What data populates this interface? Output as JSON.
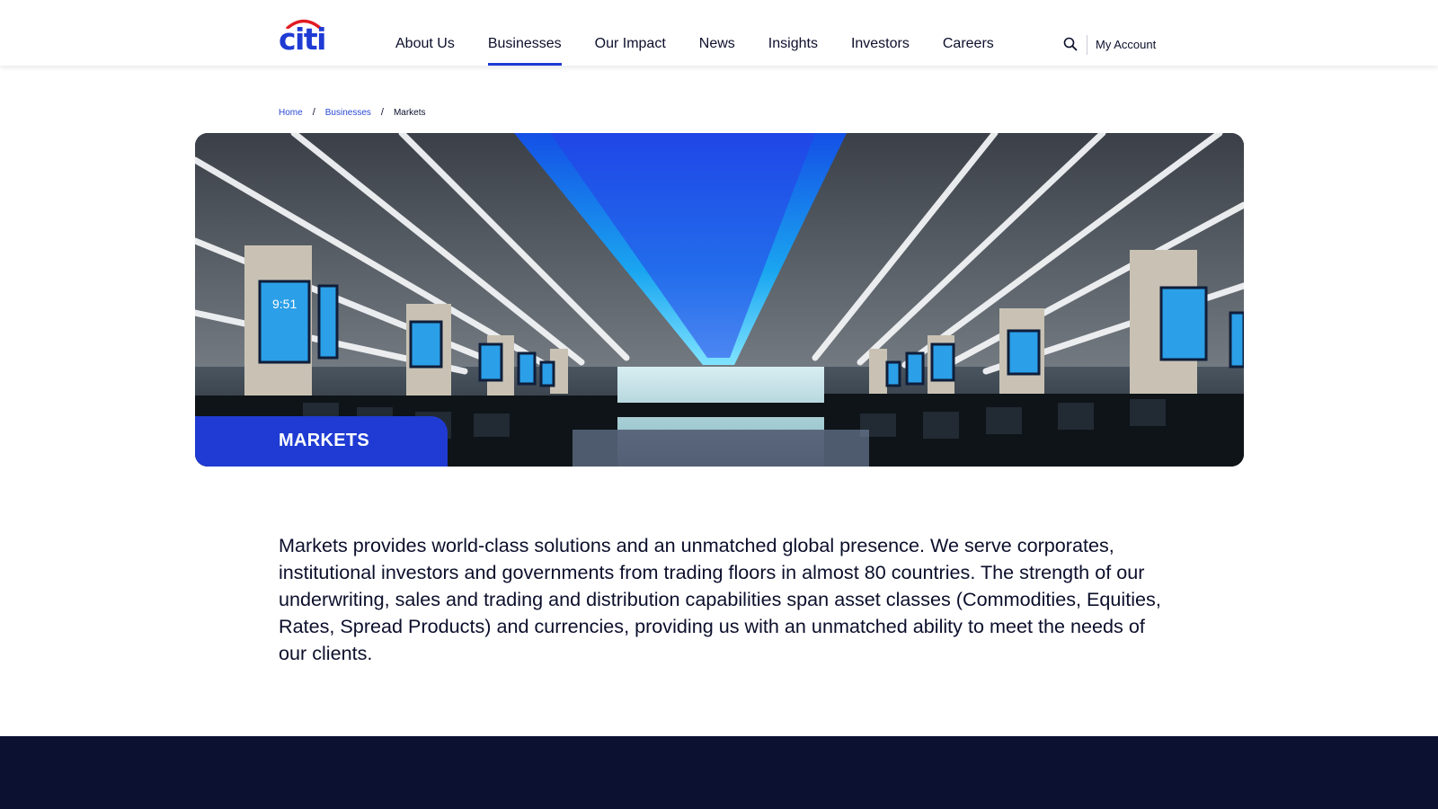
{
  "brand": {
    "name": "citi",
    "color": "#1f3bd3",
    "arc_color": "#e11b22"
  },
  "nav": {
    "items": [
      {
        "label": "About Us",
        "active": false
      },
      {
        "label": "Businesses",
        "active": true
      },
      {
        "label": "Our Impact",
        "active": false
      },
      {
        "label": "News",
        "active": false
      },
      {
        "label": "Insights",
        "active": false
      },
      {
        "label": "Investors",
        "active": false
      },
      {
        "label": "Careers",
        "active": false
      }
    ],
    "search_icon": "search-icon",
    "account_label": "My Account"
  },
  "breadcrumb": {
    "home": "Home",
    "businesses": "Businesses",
    "separator": "/",
    "current": "Markets"
  },
  "hero": {
    "label": "MARKETS",
    "label_color": "#1f3bd3",
    "screen_time": "9:51"
  },
  "description": "Markets provides world-class solutions and an unmatched global presence. We serve corporates, institutional investors and governments from trading floors in almost 80 countries. The strength of our underwriting, sales and trading and distribution capabilities span asset classes (Commodities, Equities, Rates, Spread Products) and currencies, providing us with an unmatched ability to meet the needs of our clients.",
  "colors": {
    "footer": "#0c1031",
    "link": "#2a49d6"
  }
}
